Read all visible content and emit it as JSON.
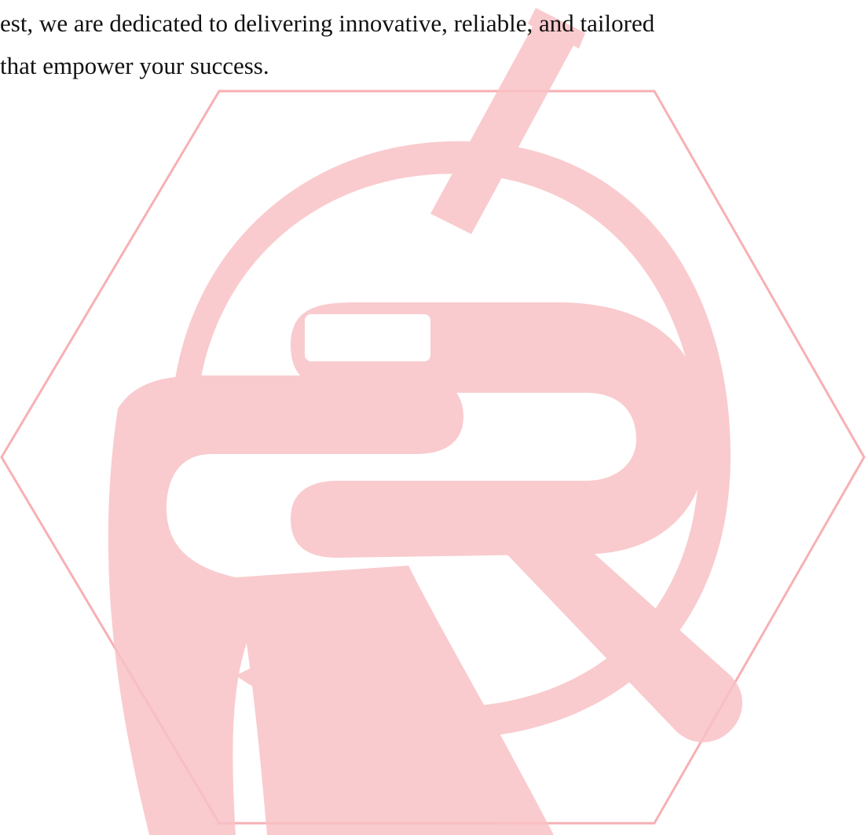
{
  "document": {
    "paragraph": {
      "line_1": "est, we are dedicated to delivering innovative, reliable, and tailored",
      "line_2": "that empower your success."
    }
  },
  "watermark": {
    "icon": "hexagon-r-logo-icon",
    "color": "#f6a3a9"
  }
}
